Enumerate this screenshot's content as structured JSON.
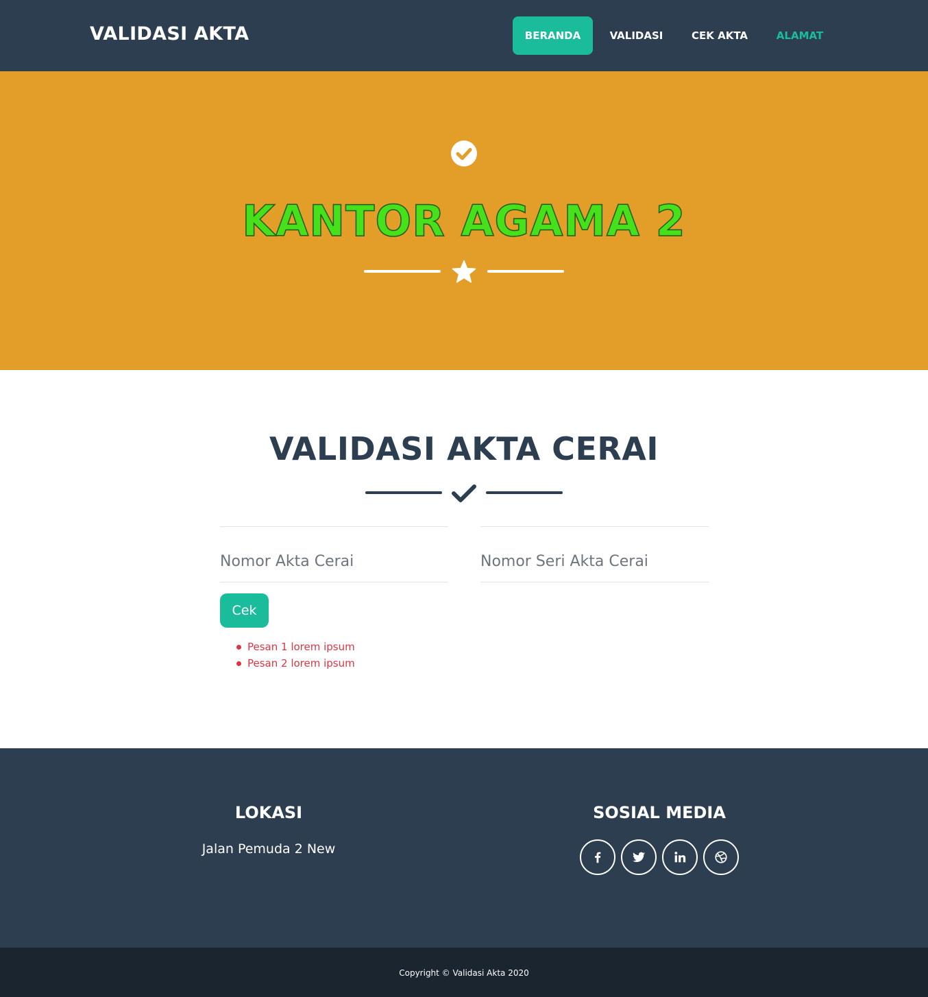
{
  "navbar": {
    "brand": "VALIDASI AKTA",
    "items": [
      {
        "label": "BERANDA",
        "state": "active"
      },
      {
        "label": "VALIDASI",
        "state": "normal"
      },
      {
        "label": "CEK AKTA",
        "state": "normal"
      },
      {
        "label": "ALAMAT",
        "state": "accent"
      }
    ]
  },
  "hero": {
    "icon": "check-circle-icon",
    "title": "KANTOR AGAMA 2",
    "divider_icon": "star-icon",
    "background": "#e39d29",
    "title_color": "#46e11a"
  },
  "main": {
    "title": "VALIDASI AKTA CERAI",
    "divider_icon": "check-icon",
    "fields": [
      {
        "placeholder": "Nomor Akta Cerai",
        "value": ""
      },
      {
        "placeholder": "Nomor Seri Akta Cerai",
        "value": ""
      }
    ],
    "button_label": "Cek",
    "messages": [
      "Pesan 1 lorem ipsum",
      "Pesan 2 lorem ipsum"
    ]
  },
  "footer": {
    "location_heading": "LOKASI",
    "location_text": "Jalan Pemuda 2 New",
    "social_heading": "SOSIAL MEDIA",
    "social_icons": [
      "facebook-icon",
      "twitter-icon",
      "linkedin-icon",
      "dribbble-icon"
    ],
    "copyright": "Copyright © Validasi Akta 2020"
  },
  "colors": {
    "primary": "#2c3e50",
    "accent": "#1abc9c",
    "error": "#dc3545",
    "footer_bottom": "#1a252f"
  }
}
